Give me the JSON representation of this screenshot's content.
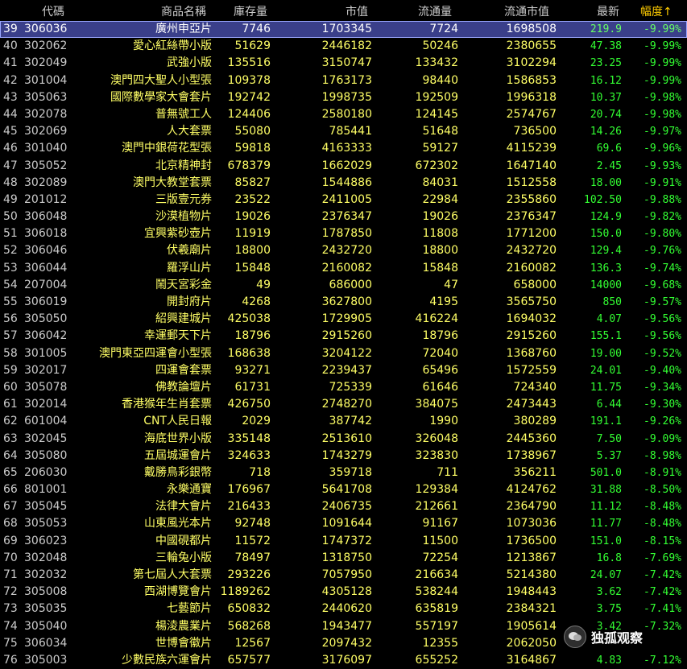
{
  "header": {
    "code": "代碼",
    "name": "商品名稱",
    "stock": "庫存量",
    "market_value": "市值",
    "circulation": "流通量",
    "circ_market_value": "流通市值",
    "latest": "最新",
    "amplitude": "幅度↑"
  },
  "rows": [
    {
      "idx": "39",
      "code": "306036",
      "name": "廣州申亞片",
      "stock": "7746",
      "mv": "1703345",
      "circ": "7724",
      "cmv": "1698508",
      "last": "219.9",
      "amp": "-9.99%"
    },
    {
      "idx": "40",
      "code": "302062",
      "name": "愛心紅絲帶小版",
      "stock": "51629",
      "mv": "2446182",
      "circ": "50246",
      "cmv": "2380655",
      "last": "47.38",
      "amp": "-9.99%"
    },
    {
      "idx": "41",
      "code": "302049",
      "name": "武強小版",
      "stock": "135516",
      "mv": "3150747",
      "circ": "133432",
      "cmv": "3102294",
      "last": "23.25",
      "amp": "-9.99%"
    },
    {
      "idx": "42",
      "code": "301004",
      "name": "澳門四大聖人小型張",
      "stock": "109378",
      "mv": "1763173",
      "circ": "98440",
      "cmv": "1586853",
      "last": "16.12",
      "amp": "-9.99%"
    },
    {
      "idx": "43",
      "code": "305063",
      "name": "國際數學家大會套片",
      "stock": "192742",
      "mv": "1998735",
      "circ": "192509",
      "cmv": "1996318",
      "last": "10.37",
      "amp": "-9.98%"
    },
    {
      "idx": "44",
      "code": "302078",
      "name": "普無號工人",
      "stock": "124406",
      "mv": "2580180",
      "circ": "124145",
      "cmv": "2574767",
      "last": "20.74",
      "amp": "-9.98%"
    },
    {
      "idx": "45",
      "code": "302069",
      "name": "人大套票",
      "stock": "55080",
      "mv": "785441",
      "circ": "51648",
      "cmv": "736500",
      "last": "14.26",
      "amp": "-9.97%"
    },
    {
      "idx": "46",
      "code": "301040",
      "name": "澳門中銀荷花型張",
      "stock": "59818",
      "mv": "4163333",
      "circ": "59127",
      "cmv": "4115239",
      "last": "69.6",
      "amp": "-9.96%"
    },
    {
      "idx": "47",
      "code": "305052",
      "name": "北京精神封",
      "stock": "678379",
      "mv": "1662029",
      "circ": "672302",
      "cmv": "1647140",
      "last": "2.45",
      "amp": "-9.93%"
    },
    {
      "idx": "48",
      "code": "302089",
      "name": "澳門大教堂套票",
      "stock": "85827",
      "mv": "1544886",
      "circ": "84031",
      "cmv": "1512558",
      "last": "18.00",
      "amp": "-9.91%"
    },
    {
      "idx": "49",
      "code": "201012",
      "name": "三版壹元券",
      "stock": "23522",
      "mv": "2411005",
      "circ": "22984",
      "cmv": "2355860",
      "last": "102.50",
      "amp": "-9.88%"
    },
    {
      "idx": "50",
      "code": "306048",
      "name": "沙漠植物片",
      "stock": "19026",
      "mv": "2376347",
      "circ": "19026",
      "cmv": "2376347",
      "last": "124.9",
      "amp": "-9.82%"
    },
    {
      "idx": "51",
      "code": "306018",
      "name": "宜興紫砂壺片",
      "stock": "11919",
      "mv": "1787850",
      "circ": "11808",
      "cmv": "1771200",
      "last": "150.0",
      "amp": "-9.80%"
    },
    {
      "idx": "52",
      "code": "306046",
      "name": "伏羲廟片",
      "stock": "18800",
      "mv": "2432720",
      "circ": "18800",
      "cmv": "2432720",
      "last": "129.4",
      "amp": "-9.76%"
    },
    {
      "idx": "53",
      "code": "306044",
      "name": "羅浮山片",
      "stock": "15848",
      "mv": "2160082",
      "circ": "15848",
      "cmv": "2160082",
      "last": "136.3",
      "amp": "-9.74%"
    },
    {
      "idx": "54",
      "code": "207004",
      "name": "鬧天宮彩金",
      "stock": "49",
      "mv": "686000",
      "circ": "47",
      "cmv": "658000",
      "last": "14000",
      "amp": "-9.68%"
    },
    {
      "idx": "55",
      "code": "306019",
      "name": "開封府片",
      "stock": "4268",
      "mv": "3627800",
      "circ": "4195",
      "cmv": "3565750",
      "last": "850",
      "amp": "-9.57%"
    },
    {
      "idx": "56",
      "code": "305050",
      "name": "紹興建城片",
      "stock": "425038",
      "mv": "1729905",
      "circ": "416224",
      "cmv": "1694032",
      "last": "4.07",
      "amp": "-9.56%"
    },
    {
      "idx": "57",
      "code": "306042",
      "name": "幸運郵天下片",
      "stock": "18796",
      "mv": "2915260",
      "circ": "18796",
      "cmv": "2915260",
      "last": "155.1",
      "amp": "-9.56%"
    },
    {
      "idx": "58",
      "code": "301005",
      "name": "澳門東亞四運會小型張",
      "stock": "168638",
      "mv": "3204122",
      "circ": "72040",
      "cmv": "1368760",
      "last": "19.00",
      "amp": "-9.52%"
    },
    {
      "idx": "59",
      "code": "302017",
      "name": "四運會套票",
      "stock": "93271",
      "mv": "2239437",
      "circ": "65496",
      "cmv": "1572559",
      "last": "24.01",
      "amp": "-9.40%"
    },
    {
      "idx": "60",
      "code": "305078",
      "name": "佛教論壇片",
      "stock": "61731",
      "mv": "725339",
      "circ": "61646",
      "cmv": "724340",
      "last": "11.75",
      "amp": "-9.34%"
    },
    {
      "idx": "61",
      "code": "302014",
      "name": "香港猴年生肖套票",
      "stock": "426750",
      "mv": "2748270",
      "circ": "384075",
      "cmv": "2473443",
      "last": "6.44",
      "amp": "-9.30%"
    },
    {
      "idx": "62",
      "code": "601004",
      "name": "CNT人民日報",
      "stock": "2029",
      "mv": "387742",
      "circ": "1990",
      "cmv": "380289",
      "last": "191.1",
      "amp": "-9.26%"
    },
    {
      "idx": "63",
      "code": "302045",
      "name": "海底世界小版",
      "stock": "335148",
      "mv": "2513610",
      "circ": "326048",
      "cmv": "2445360",
      "last": "7.50",
      "amp": "-9.09%"
    },
    {
      "idx": "64",
      "code": "305080",
      "name": "五屆城運會片",
      "stock": "324633",
      "mv": "1743279",
      "circ": "323830",
      "cmv": "1738967",
      "last": "5.37",
      "amp": "-8.98%"
    },
    {
      "idx": "65",
      "code": "206030",
      "name": "戴勝鳥彩銀幣",
      "stock": "718",
      "mv": "359718",
      "circ": "711",
      "cmv": "356211",
      "last": "501.0",
      "amp": "-8.91%"
    },
    {
      "idx": "66",
      "code": "801001",
      "name": "永樂通寶",
      "stock": "176967",
      "mv": "5641708",
      "circ": "129384",
      "cmv": "4124762",
      "last": "31.88",
      "amp": "-8.50%"
    },
    {
      "idx": "67",
      "code": "305045",
      "name": "法律大會片",
      "stock": "216433",
      "mv": "2406735",
      "circ": "212661",
      "cmv": "2364790",
      "last": "11.12",
      "amp": "-8.48%"
    },
    {
      "idx": "68",
      "code": "305053",
      "name": "山東風光本片",
      "stock": "92748",
      "mv": "1091644",
      "circ": "91167",
      "cmv": "1073036",
      "last": "11.77",
      "amp": "-8.48%"
    },
    {
      "idx": "69",
      "code": "306023",
      "name": "中國硯都片",
      "stock": "11572",
      "mv": "1747372",
      "circ": "11500",
      "cmv": "1736500",
      "last": "151.0",
      "amp": "-8.15%"
    },
    {
      "idx": "70",
      "code": "302048",
      "name": "三輪兔小版",
      "stock": "78497",
      "mv": "1318750",
      "circ": "72254",
      "cmv": "1213867",
      "last": "16.8",
      "amp": "-7.69%"
    },
    {
      "idx": "71",
      "code": "302032",
      "name": "第七屆人大套票",
      "stock": "293226",
      "mv": "7057950",
      "circ": "216634",
      "cmv": "5214380",
      "last": "24.07",
      "amp": "-7.42%"
    },
    {
      "idx": "72",
      "code": "305008",
      "name": "西湖博覽會片",
      "stock": "1189262",
      "mv": "4305128",
      "circ": "538244",
      "cmv": "1948443",
      "last": "3.62",
      "amp": "-7.42%"
    },
    {
      "idx": "73",
      "code": "305035",
      "name": "七藝節片",
      "stock": "650832",
      "mv": "2440620",
      "circ": "635819",
      "cmv": "2384321",
      "last": "3.75",
      "amp": "-7.41%"
    },
    {
      "idx": "74",
      "code": "305040",
      "name": "楊淩農業片",
      "stock": "568268",
      "mv": "1943477",
      "circ": "557197",
      "cmv": "1905614",
      "last": "3.42",
      "amp": "-7.32%"
    },
    {
      "idx": "75",
      "code": "306034",
      "name": "世博會徽片",
      "stock": "12567",
      "mv": "2097432",
      "circ": "12355",
      "cmv": "2062050",
      "last": "",
      "amp": ""
    },
    {
      "idx": "76",
      "code": "305003",
      "name": "少數民族六運會片",
      "stock": "657577",
      "mv": "3176097",
      "circ": "655252",
      "cmv": "3164867",
      "last": "4.83",
      "amp": "-7.12%"
    }
  ],
  "selected_row": "39",
  "watermark": {
    "text": "独孤观察",
    "icon": "wechat-icon"
  },
  "colors": {
    "background": "#000000",
    "text_yellow": "#ffff66",
    "text_green": "#33ff33",
    "header_accent": "#ffcc00",
    "selected_bg": "#3a3f8a"
  }
}
